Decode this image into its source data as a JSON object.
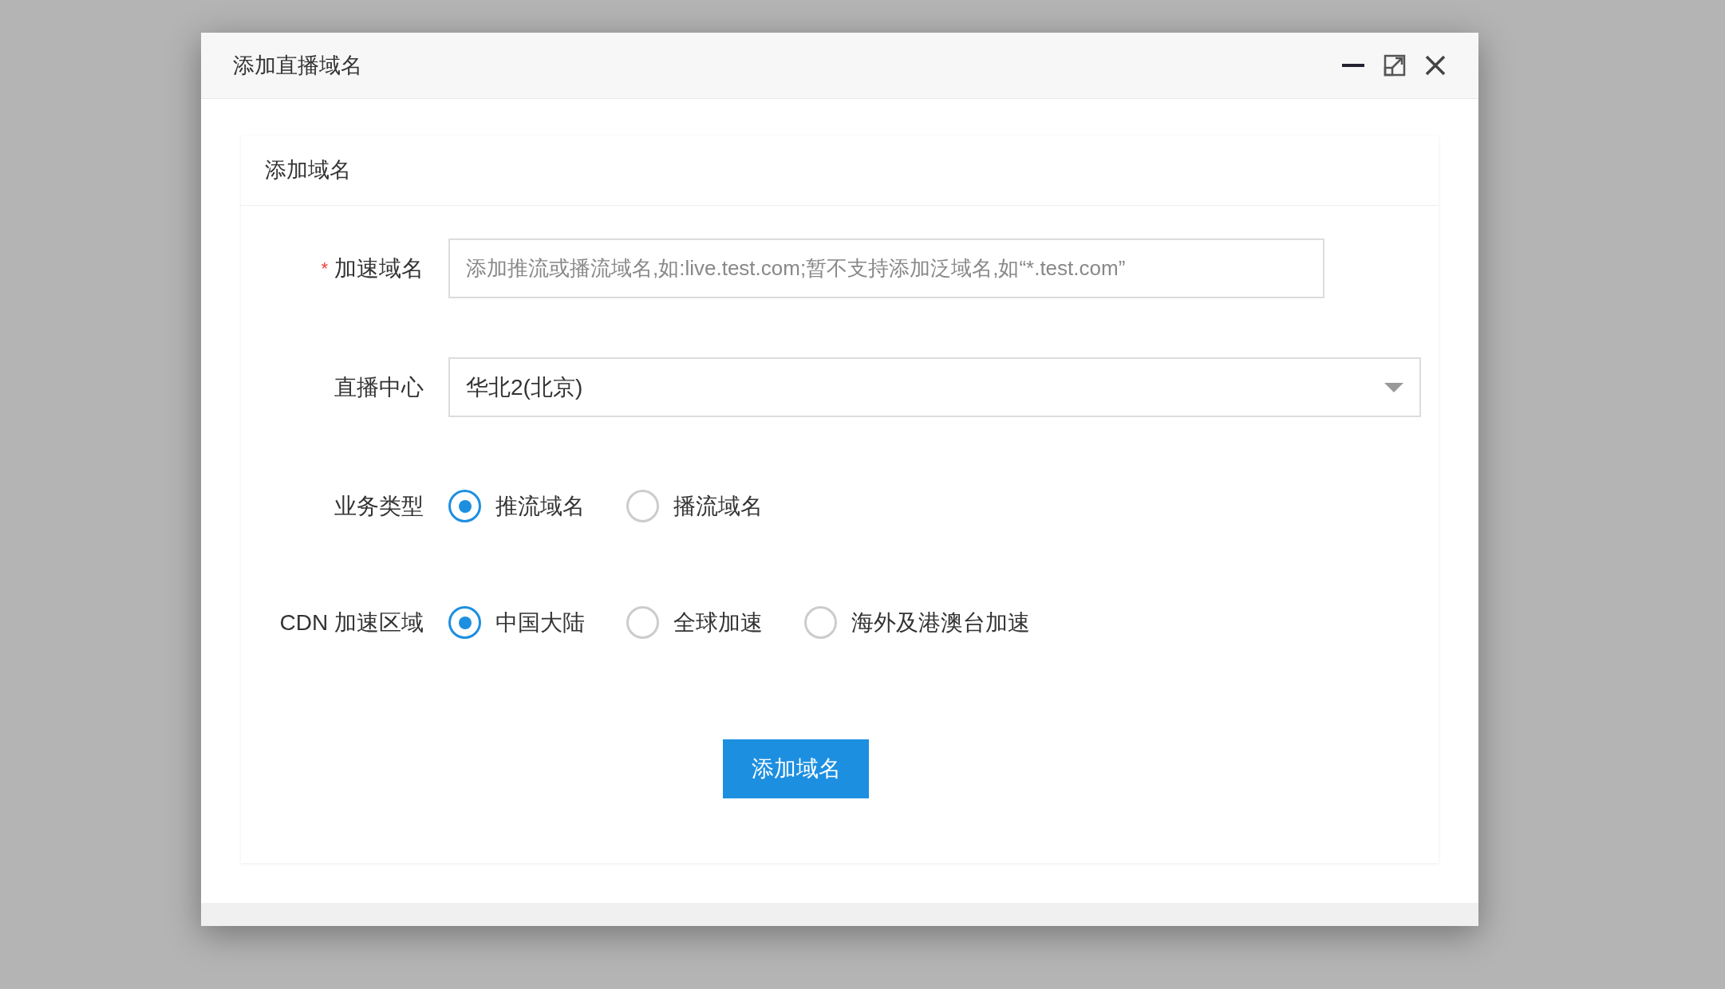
{
  "dialog": {
    "title": "添加直播域名"
  },
  "card": {
    "title": "添加域名"
  },
  "fields": [
    {
      "kind": "text",
      "label": "加速域名",
      "required_mark": "*",
      "placeholder": "添加推流或播流域名,如:live.test.com;暂不支持添加泛域名,如“*.test.com”"
    },
    {
      "kind": "select",
      "label": "直播中心",
      "value": "华北2(北京)"
    },
    {
      "kind": "radio",
      "label": "业务类型",
      "options": [
        {
          "label": "推流域名",
          "selected": true
        },
        {
          "label": "播流域名",
          "selected": false
        }
      ]
    },
    {
      "kind": "radio",
      "label": "CDN 加速区域",
      "options": [
        {
          "label": "中国大陆",
          "selected": true
        },
        {
          "label": "全球加速",
          "selected": false
        },
        {
          "label": "海外及港澳台加速",
          "selected": false
        }
      ]
    }
  ],
  "submit_button": "添加域名"
}
